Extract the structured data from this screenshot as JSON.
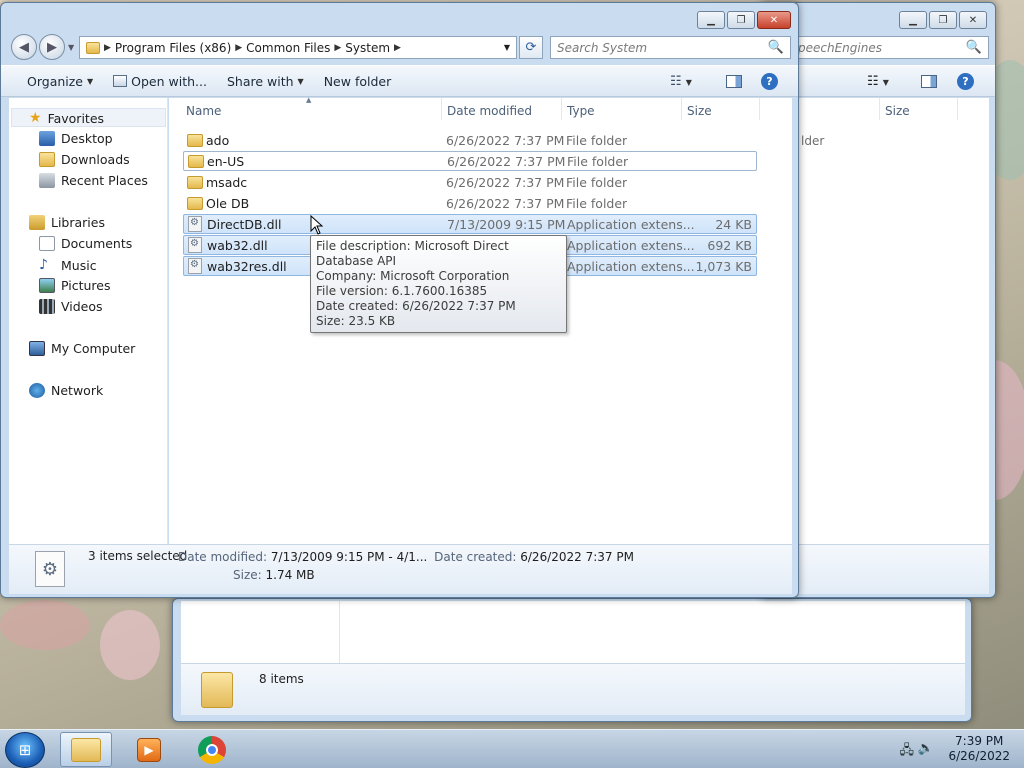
{
  "front": {
    "breadcrumb": [
      "Program Files (x86)",
      "Common Files",
      "System"
    ],
    "search_placeholder": "Search System",
    "toolbar": {
      "organize": "Organize",
      "open_with": "Open with...",
      "share_with": "Share with",
      "new_folder": "New folder"
    },
    "nav": {
      "favorites": "Favorites",
      "desktop": "Desktop",
      "downloads": "Downloads",
      "recent_places": "Recent Places",
      "libraries": "Libraries",
      "documents": "Documents",
      "music": "Music",
      "pictures": "Pictures",
      "videos": "Videos",
      "my_computer": "My Computer",
      "network": "Network"
    },
    "columns": {
      "name": "Name",
      "date": "Date modified",
      "type": "Type",
      "size": "Size"
    },
    "files": [
      {
        "name": "ado",
        "date": "6/26/2022 7:37 PM",
        "type": "File folder",
        "size": ""
      },
      {
        "name": "en-US",
        "date": "6/26/2022 7:37 PM",
        "type": "File folder",
        "size": ""
      },
      {
        "name": "msadc",
        "date": "6/26/2022 7:37 PM",
        "type": "File folder",
        "size": ""
      },
      {
        "name": "Ole DB",
        "date": "6/26/2022 7:37 PM",
        "type": "File folder",
        "size": ""
      },
      {
        "name": "DirectDB.dll",
        "date": "7/13/2009 9:15 PM",
        "type": "Application extens...",
        "size": "24 KB"
      },
      {
        "name": "wab32.dll",
        "date": "",
        "type": "Application extens...",
        "size": "692 KB"
      },
      {
        "name": "wab32res.dll",
        "date": "",
        "type": "Application extens...",
        "size": "1,073 KB"
      }
    ],
    "tooltip": {
      "line1": "File description: Microsoft Direct Database API",
      "line2": "Company: Microsoft Corporation",
      "line3": "File version: 6.1.7600.16385",
      "line4": "Date created: 6/26/2022 7:37 PM",
      "line5": "Size: 23.5 KB"
    },
    "details": {
      "selected": "3 items selected",
      "date_modified_label": "Date modified:",
      "date_modified_value": "7/13/2009 9:15 PM - 4/1...",
      "date_created_label": "Date created:",
      "date_created_value": "6/26/2022 7:37 PM",
      "size_label": "Size:",
      "size_value": "1.74 MB"
    }
  },
  "back": {
    "search_partial": "peechEngines",
    "size_column": "Size",
    "type_partial": "lder"
  },
  "third": {
    "items_count": "8 items"
  },
  "taskbar": {
    "time": "7:39 PM",
    "date": "6/26/2022"
  },
  "colors": {
    "selection": "#cfe3fa",
    "window_frame": "#c9dcf0",
    "taskbar": "#9fb4cb"
  }
}
